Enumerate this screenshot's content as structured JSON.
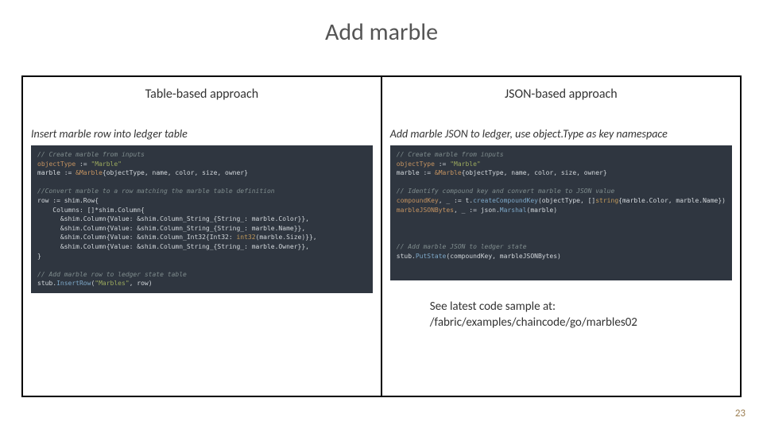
{
  "title": "Add marble",
  "page_number": "23",
  "left": {
    "heading": "Table-based approach",
    "subhead": "Insert marble row into ledger table",
    "code": {
      "c1": "// Create marble from inputs",
      "l1a": "objectType",
      "l1b": " := ",
      "l1c": "\"Marble\"",
      "l2a": "marble := ",
      "l2b": "&Marble",
      "l2c": "{objectType, name, color, size, owner}",
      "c2": "//Convert marble to a row matching the marble table definition",
      "l3": "row := shim.Row{",
      "l4": "    Columns: []*shim.Column{",
      "l5a": "      &shim.Column{Value: &shim.Column_String_{String_: marble.Color}},",
      "l6a": "      &shim.Column{Value: &shim.Column_String_{String_: marble.Name}},",
      "l7a": "      &shim.Column{Value: &shim.Column_Int32{Int32: ",
      "l7b": "int32",
      "l7c": "(marble.Size)}},",
      "l8a": "      &shim.Column{Value: &shim.Column_String_{String_: marble.Owner}},",
      "l9": "}",
      "c3": "// Add marble row to ledger state table",
      "l10a": "stub.",
      "l10b": "InsertRow",
      "l10c": "(",
      "l10d": "\"Marbles\"",
      "l10e": ", row)"
    }
  },
  "right": {
    "heading": "JSON-based approach",
    "subhead": "Add marble JSON to ledger, use object.Type as key namespace",
    "code": {
      "c1": "// Create marble from inputs",
      "l1a": "objectType",
      "l1b": " := ",
      "l1c": "\"Marble\"",
      "l2a": "marble := ",
      "l2b": "&Marble",
      "l2c": "{objectType, name, color, size, owner}",
      "c2": "// Identify compound key and convert marble to JSON value",
      "l3a": "compoundKey",
      "l3b": ", _ := t.",
      "l3c": "createCompoundKey",
      "l3d": "(objectType, []",
      "l3e": "string",
      "l3f": "{marble.Color, marble.Name})",
      "l4a": "marbleJSONBytes",
      "l4b": ", _ := json.",
      "l4c": "Marshal",
      "l4d": "(marble)",
      "c3": "// Add marble JSON to ledger state",
      "l5a": "stub.",
      "l5b": "PutState",
      "l5c": "(compoundKey, marbleJSONBytes)"
    },
    "footnote_line1": "See latest code sample at:",
    "footnote_line2": "/fabric/examples/chaincode/go/marbles02"
  }
}
